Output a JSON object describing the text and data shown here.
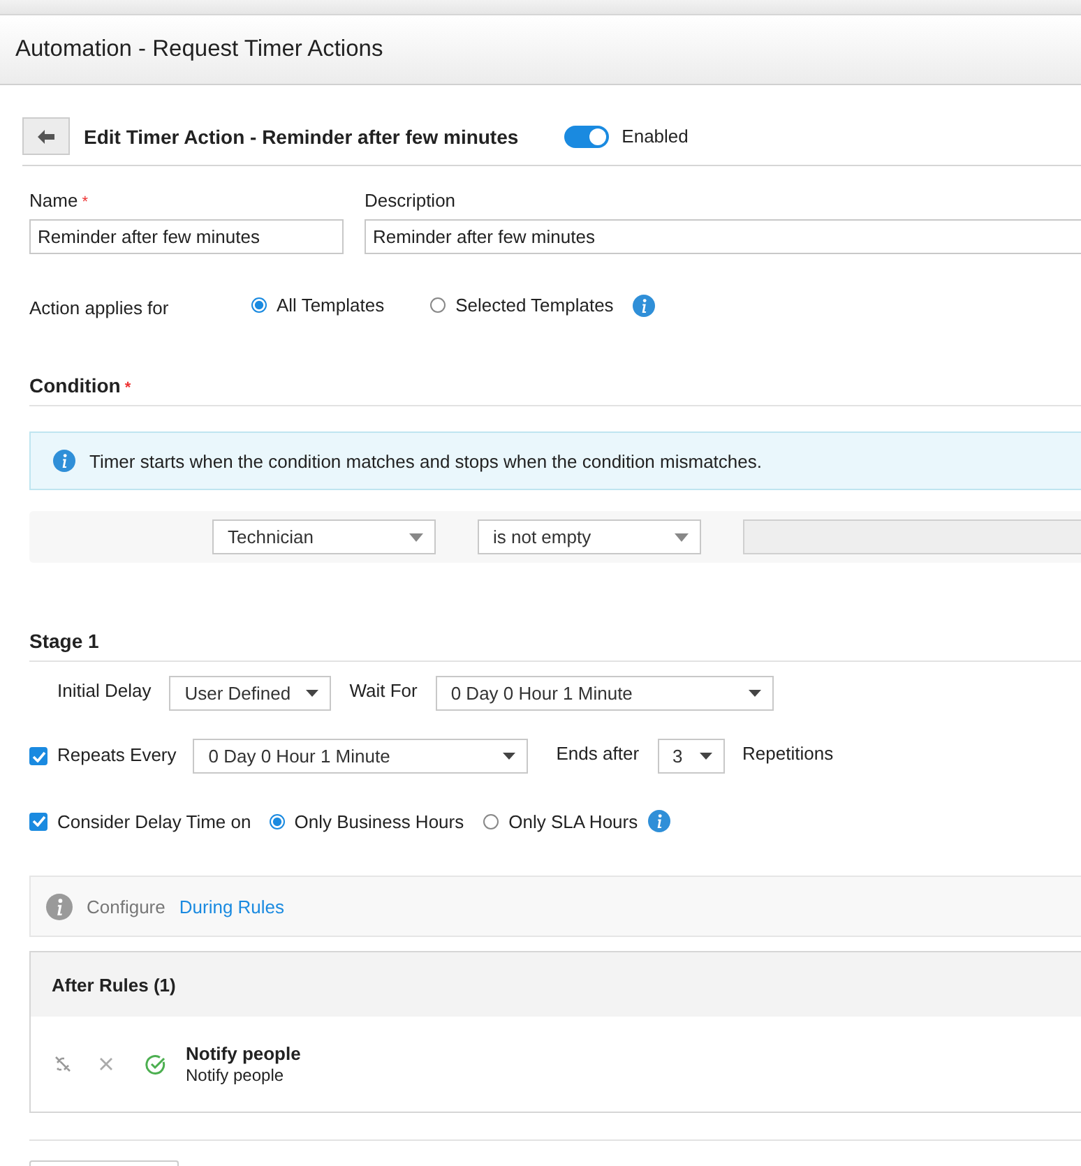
{
  "page_title": "Automation - Request Timer Actions",
  "editor": {
    "title": "Edit Timer Action - Reminder after few minutes",
    "enabled": true,
    "enabled_label": "Enabled"
  },
  "name_field": {
    "label": "Name",
    "required_mark": "*",
    "value": "Reminder after few minutes"
  },
  "description_field": {
    "label": "Description",
    "value": "Reminder after few minutes"
  },
  "applies_for": {
    "label": "Action applies for",
    "options": [
      {
        "label": "All Templates",
        "selected": true
      },
      {
        "label": "Selected Templates",
        "selected": false
      }
    ]
  },
  "condition": {
    "title": "Condition",
    "required_mark": "*",
    "info": "Timer starts when the condition matches and stops when the condition mismatches.",
    "field": "Technician",
    "operator": "is not empty"
  },
  "stage": {
    "title": "Stage 1",
    "initial_delay_label": "Initial Delay",
    "initial_delay": "User Defined",
    "wait_for_label": "Wait For",
    "wait_for": "0 Day 0 Hour 1 Minute",
    "repeats": {
      "label": "Repeats Every",
      "checked": true,
      "value": "0 Day 0 Hour 1 Minute"
    },
    "ends_after_label": "Ends after",
    "ends_after": "3",
    "repetitions_label": "Repetitions",
    "consider_delay": {
      "label": "Consider Delay Time on",
      "checked": true,
      "options": [
        {
          "label": "Only Business Hours",
          "selected": true
        },
        {
          "label": "Only SLA Hours",
          "selected": false
        }
      ]
    }
  },
  "during_rules": {
    "prefix": "Configure",
    "link": "During Rules"
  },
  "after_rules": {
    "title": "After Rules (1)",
    "rules": [
      {
        "title": "Notify people",
        "subtitle": "Notify people"
      }
    ]
  }
}
